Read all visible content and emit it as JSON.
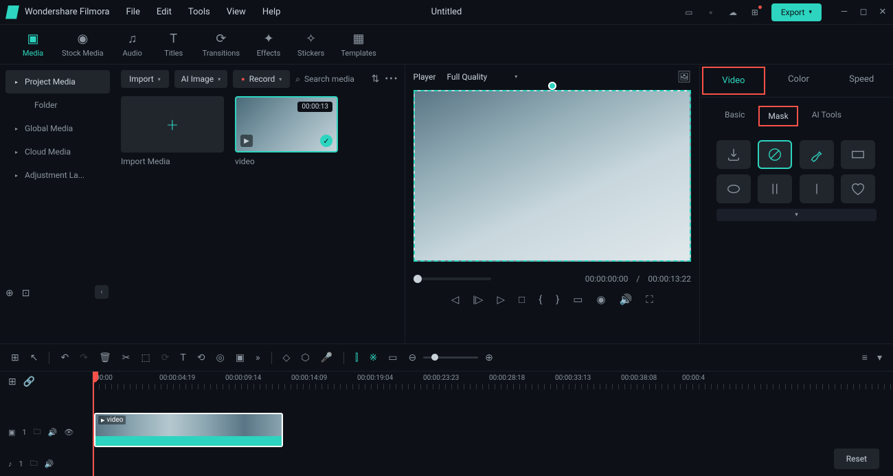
{
  "app": {
    "name": "Wondershare Filmora",
    "document": "Untitled"
  },
  "menu": [
    "File",
    "Edit",
    "Tools",
    "View",
    "Help"
  ],
  "export_label": "Export",
  "toolbar": [
    {
      "label": "Media",
      "active": true
    },
    {
      "label": "Stock Media"
    },
    {
      "label": "Audio"
    },
    {
      "label": "Titles"
    },
    {
      "label": "Transitions"
    },
    {
      "label": "Effects"
    },
    {
      "label": "Stickers"
    },
    {
      "label": "Templates"
    }
  ],
  "sidebar": {
    "project_media": "Project Media",
    "folder": "Folder",
    "global": "Global Media",
    "cloud": "Cloud Media",
    "adjust": "Adjustment La..."
  },
  "media_panel": {
    "import": "Import",
    "ai_image": "AI Image",
    "record": "Record",
    "search_placeholder": "Search media",
    "tile1_label": "Import Media",
    "tile2_label": "video",
    "tile2_duration": "00:00:13"
  },
  "preview": {
    "player": "Player",
    "quality": "Full Quality",
    "current_time": "00:00:00:00",
    "total_time": "00:00:13:22"
  },
  "right_panel": {
    "tabs": [
      "Video",
      "Color",
      "Speed"
    ],
    "subtabs": [
      "Basic",
      "Mask",
      "AI Tools"
    ],
    "reset": "Reset"
  },
  "timeline": {
    "ticks": [
      "00:00",
      "00:00:04:19",
      "00:00:09:14",
      "00:00:14:09",
      "00:00:19:04",
      "00:00:23:23",
      "00:00:28:18",
      "00:00:33:13",
      "00:00:38:08",
      "00:00:4"
    ],
    "clip_label": "video",
    "video_track": "1",
    "audio_track": "1"
  }
}
